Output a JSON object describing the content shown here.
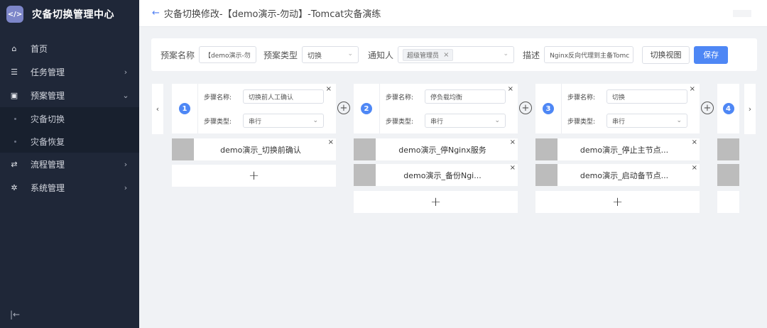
{
  "app": {
    "title": "灾备切换管理中心",
    "logo_text": "</>"
  },
  "sidebar": {
    "items": [
      {
        "label": "首页",
        "icon": "home-icon",
        "glyph": "⌂"
      },
      {
        "label": "任务管理",
        "icon": "task-icon",
        "glyph": "☰",
        "chevron": "›"
      },
      {
        "label": "预案管理",
        "icon": "plan-icon",
        "glyph": "▣",
        "chevron": "⌄"
      },
      {
        "label": "流程管理",
        "icon": "flow-icon",
        "glyph": "⇄",
        "chevron": "›"
      },
      {
        "label": "系统管理",
        "icon": "settings-icon",
        "glyph": "✲",
        "chevron": "›"
      }
    ],
    "submenu": [
      {
        "label": "灾备切换"
      },
      {
        "label": "灾备恢复"
      }
    ],
    "collapse_glyph": "|←"
  },
  "header": {
    "back_glyph": "←",
    "title": "灾备切换修改-【demo演示-勿动】-Tomcat灾备演练"
  },
  "toolbar": {
    "plan_name_label": "预案名称",
    "plan_name_value": "【demo演示-勿",
    "plan_type_label": "预案类型",
    "plan_type_value": "切换",
    "notify_label": "通知人",
    "notify_tag": "超级管理员",
    "tag_close": "×",
    "desc_label": "描述",
    "desc_value": "Nginx反向代理到主备Tomc",
    "switch_view_label": "切换视图",
    "save_label": "保存",
    "select_arrow": "⌄"
  },
  "steps_nav": {
    "prev": "‹",
    "next": "›",
    "add_between": "+"
  },
  "step_labels": {
    "name_label": "步骤名称:",
    "type_label": "步骤类型:",
    "close": "×",
    "add_task": "+",
    "type_arrow": "⌄"
  },
  "steps": [
    {
      "number": "1",
      "name": "切换前人工确认",
      "type": "串行",
      "tasks": [
        "demo演示_切换前确认"
      ]
    },
    {
      "number": "2",
      "name": "停负载均衡",
      "type": "串行",
      "tasks": [
        "demo演示_停Nginx服务",
        "demo演示_备份Ngi..."
      ]
    },
    {
      "number": "3",
      "name": "切换",
      "type": "串行",
      "tasks": [
        "demo演示_停止主节点...",
        "demo演示_启动备节点..."
      ]
    },
    {
      "number": "4"
    }
  ]
}
